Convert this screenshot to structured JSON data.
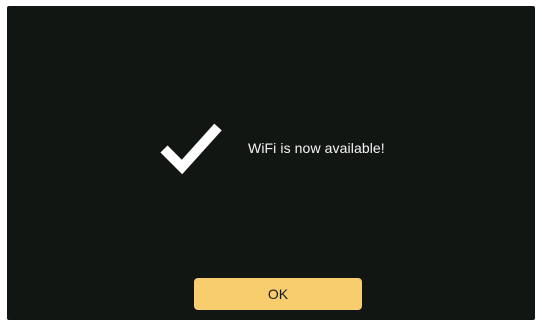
{
  "dialog": {
    "message": "WiFi is now available!",
    "icon": "checkmark-icon",
    "ok_label": "OK"
  },
  "colors": {
    "background": "#121613",
    "text": "#f4f4f4",
    "button": "#f7cd6e",
    "button_text": "#1a1a1a",
    "icon": "#ffffff"
  }
}
